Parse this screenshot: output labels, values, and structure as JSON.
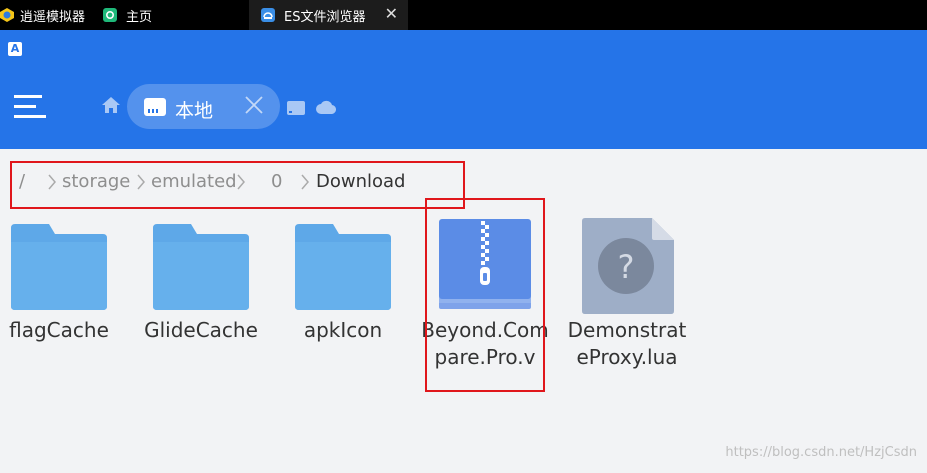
{
  "tabs": [
    {
      "label": "逍遥模拟器"
    },
    {
      "label": "主页"
    },
    {
      "label": "ES文件浏览器"
    }
  ],
  "header": {
    "badge": "A",
    "location_label": "本地"
  },
  "breadcrumb": {
    "root": "/",
    "segments": [
      "storage",
      "emulated",
      "0",
      "Download"
    ]
  },
  "files": [
    {
      "name": "flagCache",
      "type": "folder"
    },
    {
      "name": "GlideCache",
      "type": "folder"
    },
    {
      "name": "apkIcon",
      "type": "folder"
    },
    {
      "name": "Beyond.Compare.Pro.v",
      "type": "zip"
    },
    {
      "name": "DemonstrateProxy.lua",
      "type": "unknown"
    }
  ],
  "colors": {
    "header_bg": "#2574e8",
    "folder": "#5ea8e8",
    "zip": "#5b8ce6",
    "unknown": "#9eaec7",
    "highlight": "#e0161b"
  },
  "watermark": "https://blog.csdn.net/HzjCsdn"
}
